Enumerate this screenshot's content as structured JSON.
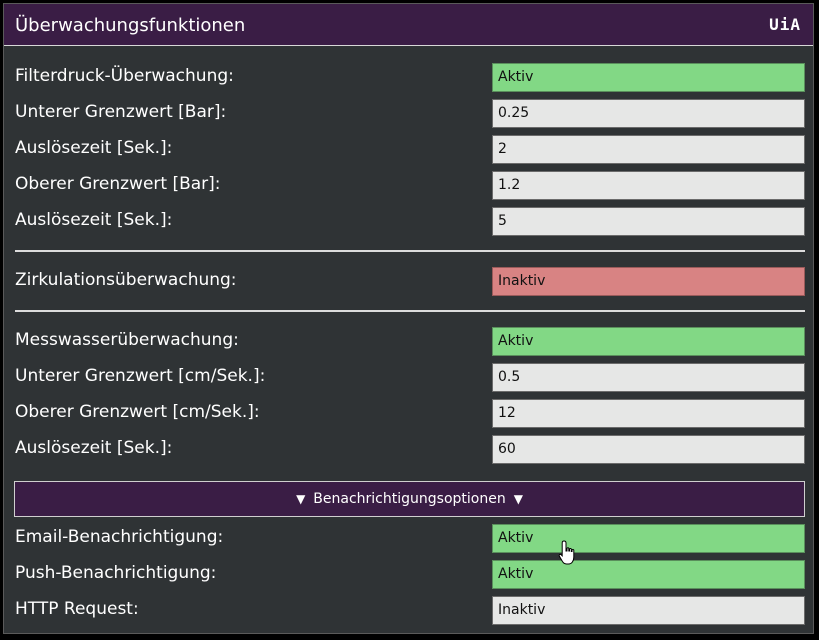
{
  "window": {
    "title": "Überwachungsfunktionen",
    "logo_text": "UiA"
  },
  "filter": {
    "rows": [
      {
        "label": "Filterdruck-Überwachung:",
        "value": "Aktiv",
        "status": "active"
      },
      {
        "label": "Unterer Grenzwert [Bar]:",
        "value": "0.25"
      },
      {
        "label": "Auslösezeit [Sek.]:",
        "value": "2"
      },
      {
        "label": "Oberer Grenzwert [Bar]:",
        "value": "1.2"
      },
      {
        "label": "Auslösezeit [Sek.]:",
        "value": "5"
      }
    ]
  },
  "circulation": {
    "rows": [
      {
        "label": "Zirkulationsüberwachung:",
        "value": "Inaktiv",
        "status": "inactive"
      }
    ]
  },
  "measure": {
    "rows": [
      {
        "label": "Messwasserüberwachung:",
        "value": "Aktiv",
        "status": "active"
      },
      {
        "label": "Unterer Grenzwert [cm/Sek.]:",
        "value": "0.5"
      },
      {
        "label": "Oberer Grenzwert [cm/Sek.]:",
        "value": "12"
      },
      {
        "label": "Auslösezeit [Sek.]:",
        "value": "60"
      }
    ]
  },
  "notifications": {
    "toggle_label": "Benachrichtigungsoptionen",
    "toggle_icon": "triangle-down-icon",
    "rows": [
      {
        "label": "Email-Benachrichtigung:",
        "value": "Aktiv",
        "status": "active"
      },
      {
        "label": "Push-Benachrichtigung:",
        "value": "Aktiv",
        "status": "active"
      },
      {
        "label": "HTTP Request:",
        "value": "Inaktiv",
        "status": "neutral"
      }
    ]
  },
  "colors": {
    "header_bg": "#3a1d45",
    "panel_bg": "#2f3335",
    "active": "#82d885",
    "inactive": "#d88383",
    "neutral": "#e6e7e6"
  },
  "cursor_icon": "hand-pointer-icon"
}
